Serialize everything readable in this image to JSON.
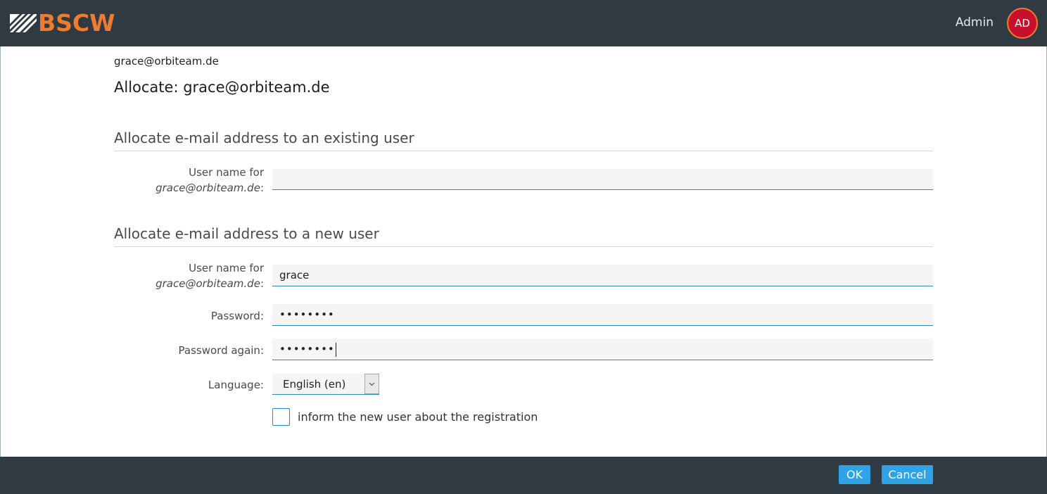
{
  "header": {
    "logo_text": "BSCW",
    "user_label": "Admin",
    "avatar_initials": "AD",
    "colors": {
      "bar": "#303a42",
      "logo": "#ef7b2e",
      "avatar_bg": "#c8102e",
      "accent": "#2ea3e6"
    }
  },
  "breadcrumb": "grace@orbiteam.de",
  "page_title": "Allocate: grace@orbiteam.de",
  "existing_user": {
    "heading": "Allocate e-mail address to an existing user",
    "label_line1": "User name for",
    "label_email": "grace@orbiteam.de",
    "label_suffix": ":",
    "value": ""
  },
  "new_user": {
    "heading": "Allocate e-mail address to a new user",
    "username_label_line1": "User name for",
    "username_label_email": "grace@orbiteam.de",
    "username_label_suffix": ":",
    "username_value": "grace",
    "password_label": "Password:",
    "password_value": "••••••••",
    "password_again_label": "Password again:",
    "password_again_value": "••••••••",
    "language_label": "Language:",
    "language_value": "English (en)",
    "inform_label": "inform the new user about the registration",
    "inform_checked": false
  },
  "footer": {
    "ok_label": "OK",
    "cancel_label": "Cancel"
  }
}
